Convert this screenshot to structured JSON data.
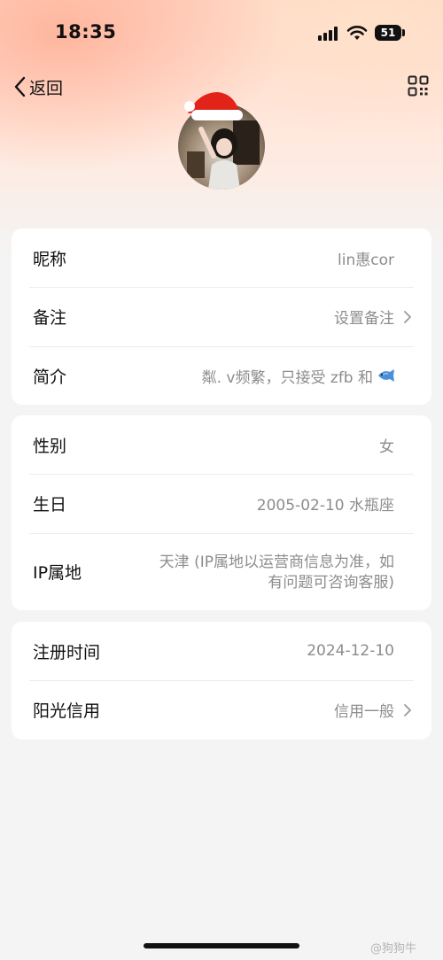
{
  "status_bar": {
    "time": "18:35",
    "battery": "51"
  },
  "nav": {
    "back_label": "返回"
  },
  "card1": {
    "rows": [
      {
        "label": "昵称",
        "value": "lin惠cor"
      },
      {
        "label": "备注",
        "value": "设置备注"
      },
      {
        "label": "简介",
        "value": "粼. v频繁，只接受 zfb 和"
      }
    ]
  },
  "card2": {
    "rows": [
      {
        "label": "性别",
        "value": "女"
      },
      {
        "label": "生日",
        "value": "2005-02-10 水瓶座"
      },
      {
        "label": "IP属地",
        "value_line1": "天津 (IP属地以运营商信息为准，如",
        "value_line2": "有问题可咨询客服)"
      }
    ]
  },
  "card3": {
    "rows": [
      {
        "label": "注册时间",
        "value": "2024-12-10"
      },
      {
        "label": "阳光信用",
        "value": "信用一般"
      }
    ]
  },
  "watermark": "@狗狗牛",
  "icons": [
    "chevron-left-icon",
    "qr-code-icon",
    "chevron-right-icon",
    "fish-emoji-icon",
    "signal-icon",
    "wifi-icon",
    "battery-icon",
    "santa-hat-icon"
  ]
}
